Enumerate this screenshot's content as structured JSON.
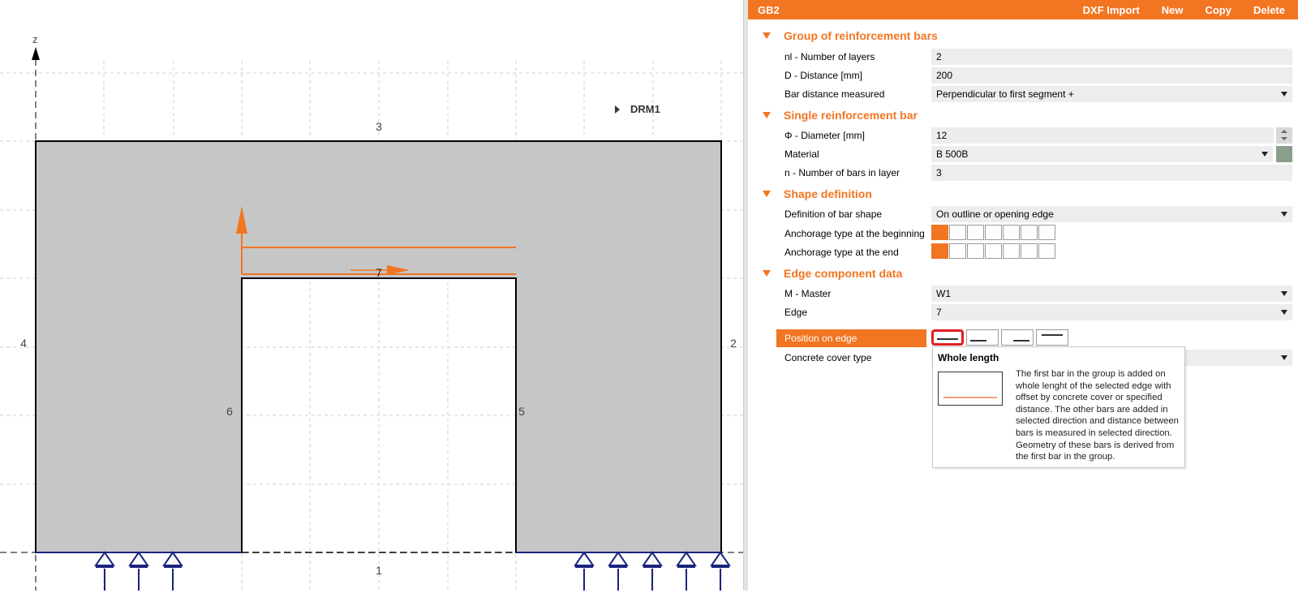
{
  "canvas": {
    "axis_label": "z",
    "drm_label": "DRM1",
    "edge_labels": [
      "1",
      "2",
      "3",
      "4",
      "5",
      "6",
      "7"
    ]
  },
  "header": {
    "title": "GB2",
    "buttons": [
      "DXF Import",
      "New",
      "Copy",
      "Delete"
    ]
  },
  "sections": {
    "group": "Group of reinforcement bars",
    "single": "Single reinforcement bar",
    "shape": "Shape definition",
    "edge": "Edge component data"
  },
  "fields": {
    "nl_label": "nl - Number of layers",
    "nl_value": "2",
    "d_label": "D - Distance [mm]",
    "d_value": "200",
    "bdm_label": "Bar distance measured",
    "bdm_value": "Perpendicular to first segment +",
    "diam_label": "Φ - Diameter [mm]",
    "diam_value": "12",
    "mat_label": "Material",
    "mat_value": "B 500B",
    "nbars_label": "n - Number of bars in layer",
    "nbars_value": "3",
    "defshape_label": "Definition of bar shape",
    "defshape_value": "On outline or opening edge",
    "anch_begin_label": "Anchorage type at the beginning",
    "anch_end_label": "Anchorage type at the end",
    "master_label": "M - Master",
    "master_value": "W1",
    "edge_label": "Edge",
    "edge_value": "7",
    "pos_label": "Position on edge",
    "cover_label": "Concrete cover type"
  },
  "tooltip": {
    "title": "Whole length",
    "text": "The first bar in the group is added on whole lenght of the selected edge with offset by concrete cover or specified distance. The other bars are added in selected direction and distance between bars is measured in selected direction. Geometry of these bars is derived from the first bar in the group."
  },
  "colors": {
    "accent": "#f27522",
    "support": "#1a237e",
    "highlight": "#e02020"
  }
}
